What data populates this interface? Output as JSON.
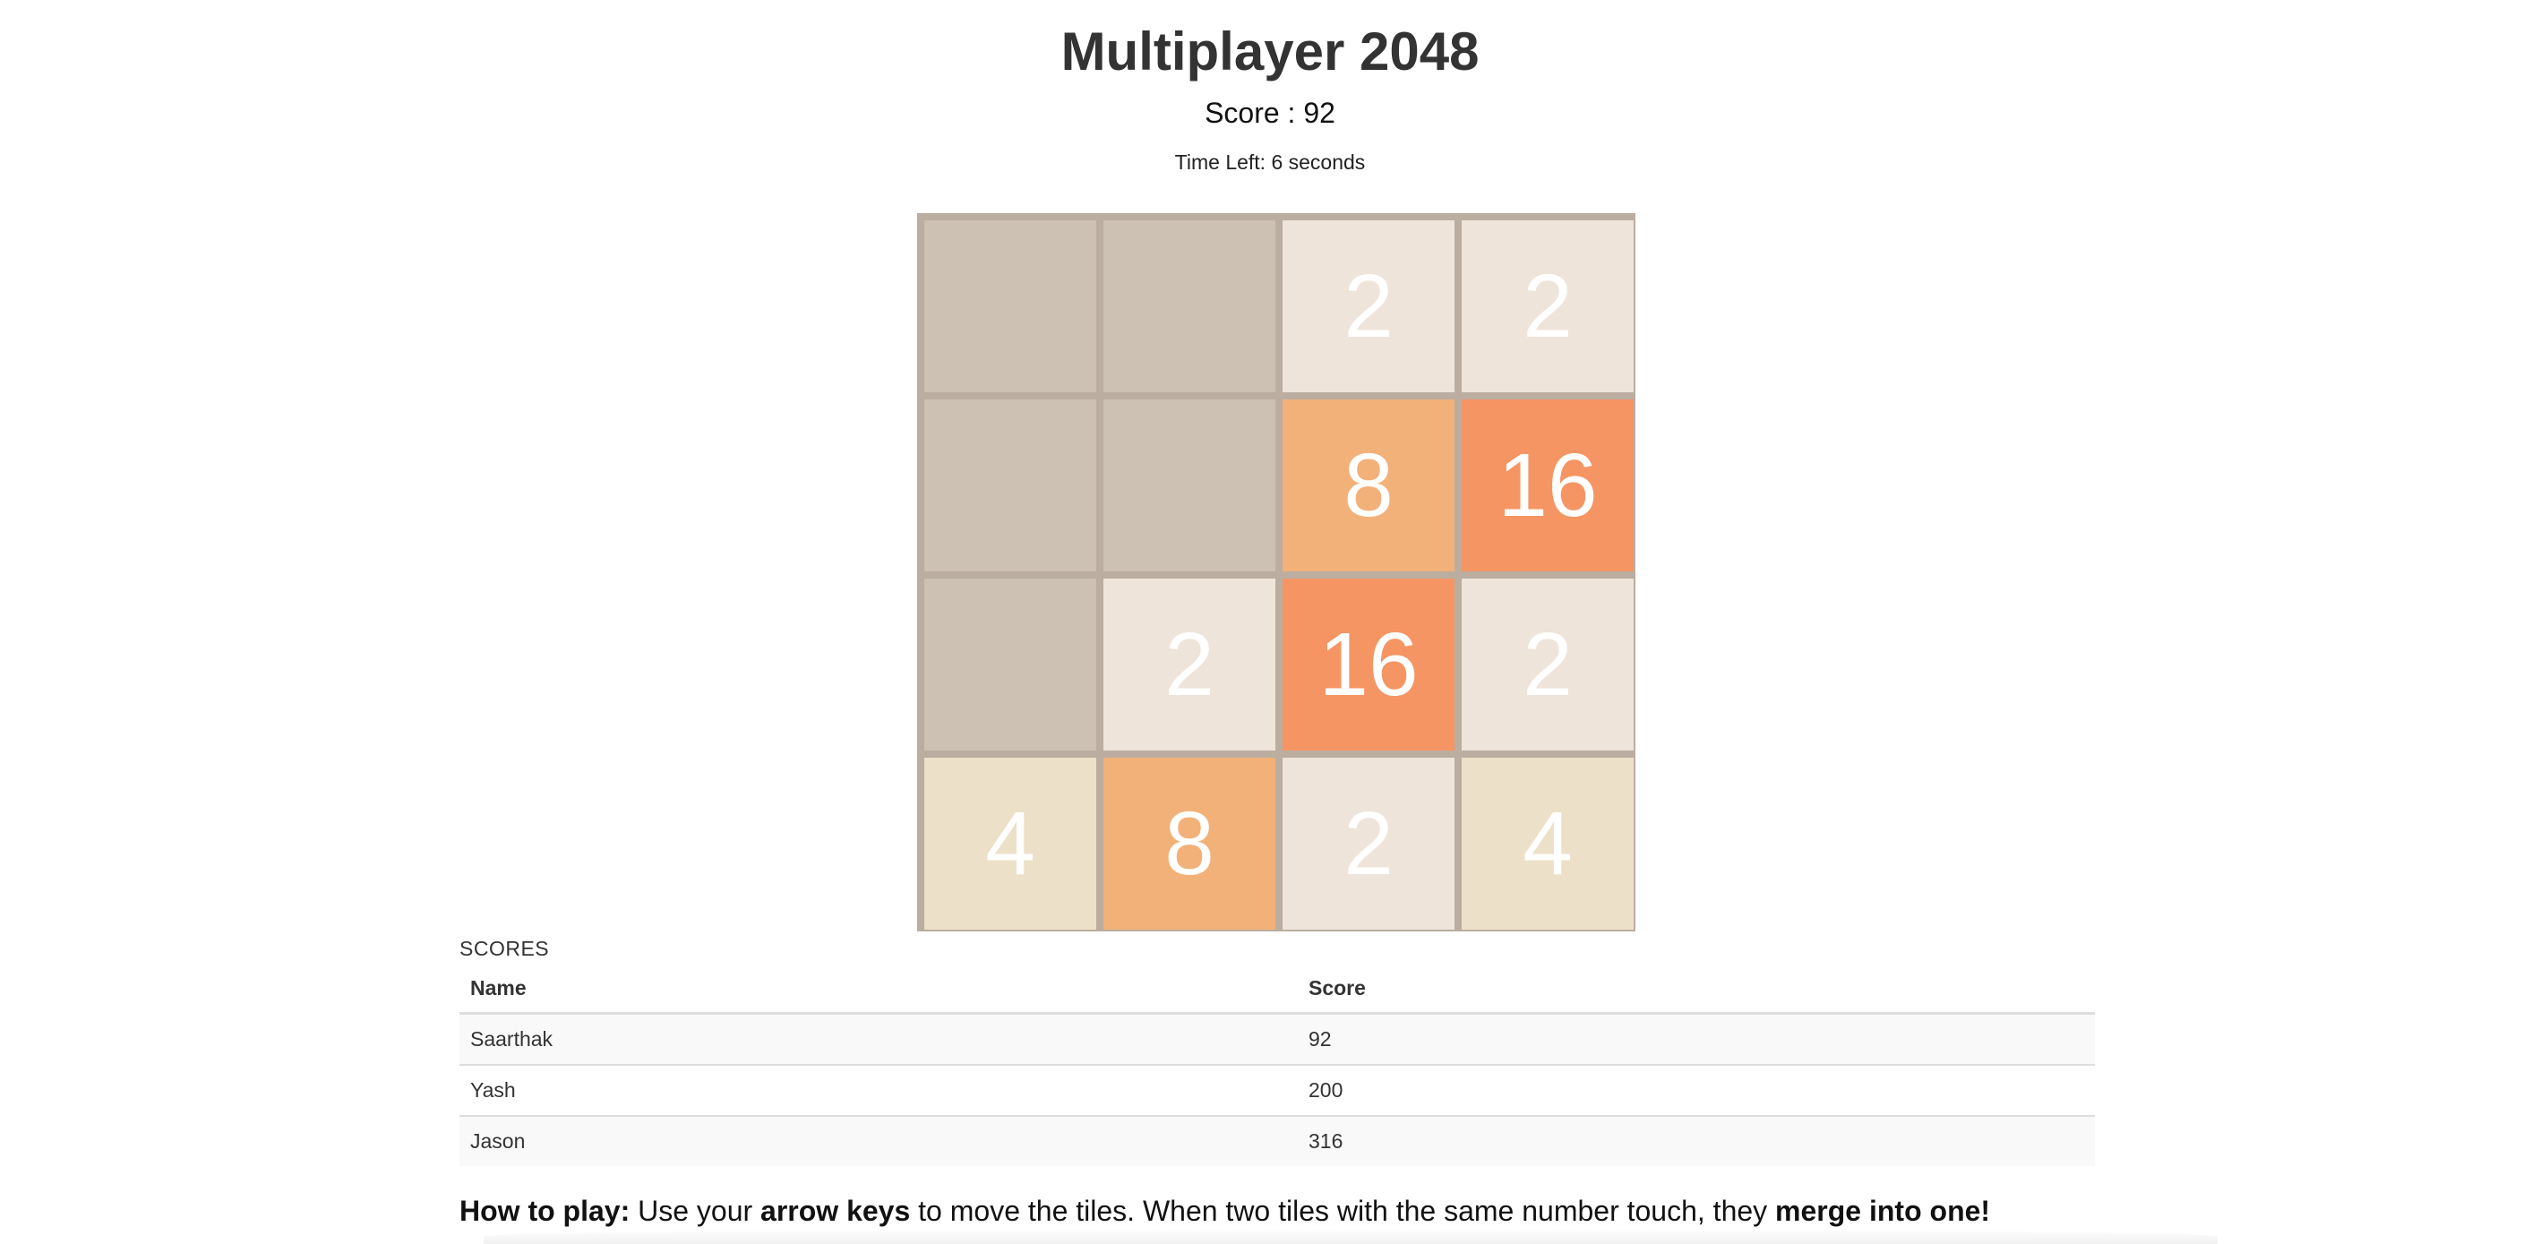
{
  "header": {
    "title": "Multiplayer 2048",
    "score_text": "Score : 92",
    "time_text": "Time Left: 6 seconds"
  },
  "board": {
    "size": 4,
    "cells": [
      [
        null,
        null,
        2,
        2
      ],
      [
        null,
        null,
        8,
        16
      ],
      [
        null,
        2,
        16,
        2
      ],
      [
        4,
        8,
        2,
        4
      ]
    ],
    "colors": {
      "board": "#bbada0",
      "empty": "#cdc1b4",
      "2": "#eee4da",
      "4": "#ede0c8",
      "8": "#f2b179",
      "16": "#f59563",
      "text": "#ffffff"
    }
  },
  "scores": {
    "caption": "SCORES",
    "headers": {
      "name": "Name",
      "score": "Score"
    },
    "rows": [
      {
        "name": "Saarthak",
        "score": "92"
      },
      {
        "name": "Yash",
        "score": "200"
      },
      {
        "name": "Jason",
        "score": "316"
      }
    ]
  },
  "instructions": {
    "lead": "How to play:",
    "part1": " Use your ",
    "keys": "arrow keys",
    "part2": " to move the tiles. When two tiles with the same number touch, they ",
    "merge": "merge into one!"
  }
}
